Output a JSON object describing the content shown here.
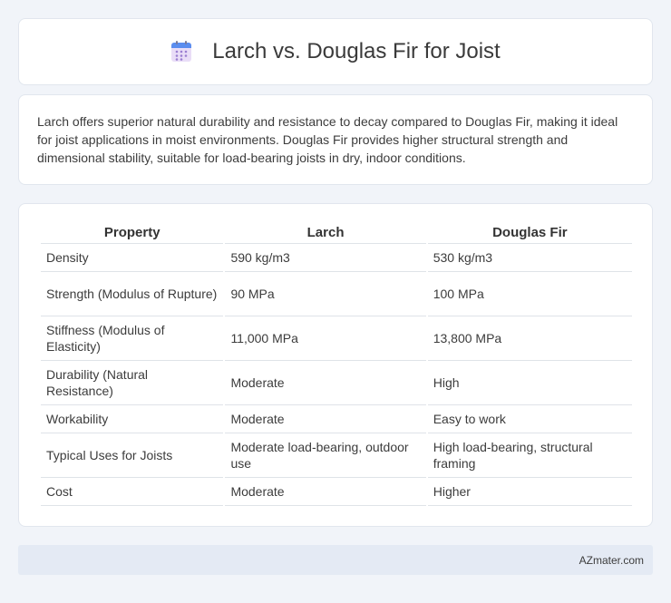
{
  "header": {
    "title": "Larch vs. Douglas Fir for Joist",
    "icon": "calendar-icon"
  },
  "intro": {
    "text": "Larch offers superior natural durability and resistance to decay compared to Douglas Fir, making it ideal for joist applications in moist environments. Douglas Fir provides higher structural strength and dimensional stability, suitable for load-bearing joists in dry, indoor conditions."
  },
  "table": {
    "headers": [
      "Property",
      "Larch",
      "Douglas Fir"
    ],
    "rows": [
      [
        "Density",
        "590 kg/m3",
        "530 kg/m3"
      ],
      [
        "Strength (Modulus of Rupture)",
        "90 MPa",
        "100 MPa"
      ],
      [
        "Stiffness (Modulus of Elasticity)",
        "11,000 MPa",
        "13,800 MPa"
      ],
      [
        "Durability (Natural Resistance)",
        "Moderate",
        "High"
      ],
      [
        "Workability",
        "Moderate",
        "Easy to work"
      ],
      [
        "Typical Uses for Joists",
        "Moderate load-bearing, outdoor use",
        "High load-bearing, structural framing"
      ],
      [
        "Cost",
        "Moderate",
        "Higher"
      ]
    ]
  },
  "footer": {
    "brand": "AZmater.com"
  }
}
